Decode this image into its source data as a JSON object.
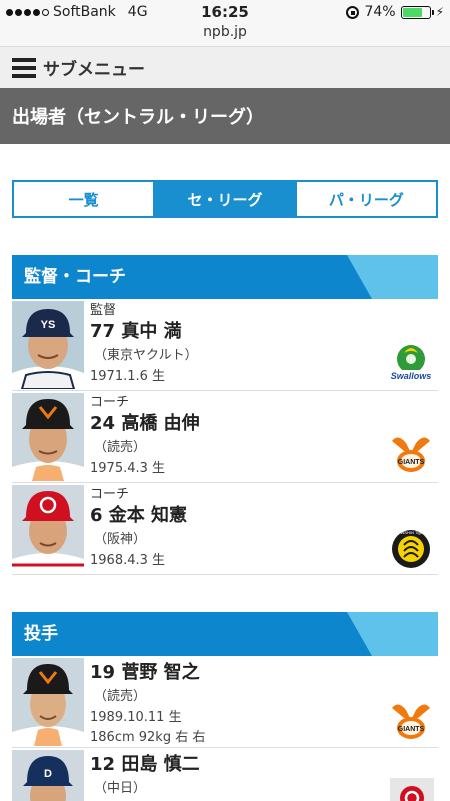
{
  "status_bar": {
    "carrier": "SoftBank",
    "network": "4G",
    "time": "16:25",
    "url": "npb.jp",
    "battery": "74%",
    "battery_level": 0.74
  },
  "submenu": {
    "label": "サブメニュー"
  },
  "title": "出場者（セントラル・リーグ）",
  "tabs": [
    {
      "label": "一覧",
      "active": false
    },
    {
      "label": "セ・リーグ",
      "active": true
    },
    {
      "label": "パ・リーグ",
      "active": false
    }
  ],
  "sections": [
    {
      "label": "監督・コーチ",
      "rows": [
        {
          "role": "監督",
          "number_name": "77 真中 満",
          "team": "（東京ヤクルト）",
          "born": "1971.1.6 生",
          "body": ""
        },
        {
          "role": "コーチ",
          "number_name": "24 高橋 由伸",
          "team": "（読売）",
          "born": "1975.4.3 生",
          "body": ""
        },
        {
          "role": "コーチ",
          "number_name": "6 金本 知憲",
          "team": "（阪神）",
          "born": "1968.4.3 生",
          "body": ""
        }
      ]
    },
    {
      "label": "投手",
      "rows": [
        {
          "role": "",
          "number_name": "19 菅野 智之",
          "team": "（読売）",
          "born": "1989.10.11 生",
          "body": "186cm 92kg 右 右"
        },
        {
          "role": "",
          "number_name": "12 田島 慎二",
          "team": "（中日）",
          "born": "",
          "body": ""
        }
      ]
    }
  ],
  "logos": {
    "swallows_text": "Swallows",
    "giants_text": "GIANTS",
    "tigers_text": "HANSHIN Tigers"
  },
  "colors": {
    "accent": "#1a8fd0",
    "section_dark": "#0d86cd",
    "section_light": "#5fc2ea",
    "title_bg": "#666666",
    "battery": "#4cd964"
  }
}
